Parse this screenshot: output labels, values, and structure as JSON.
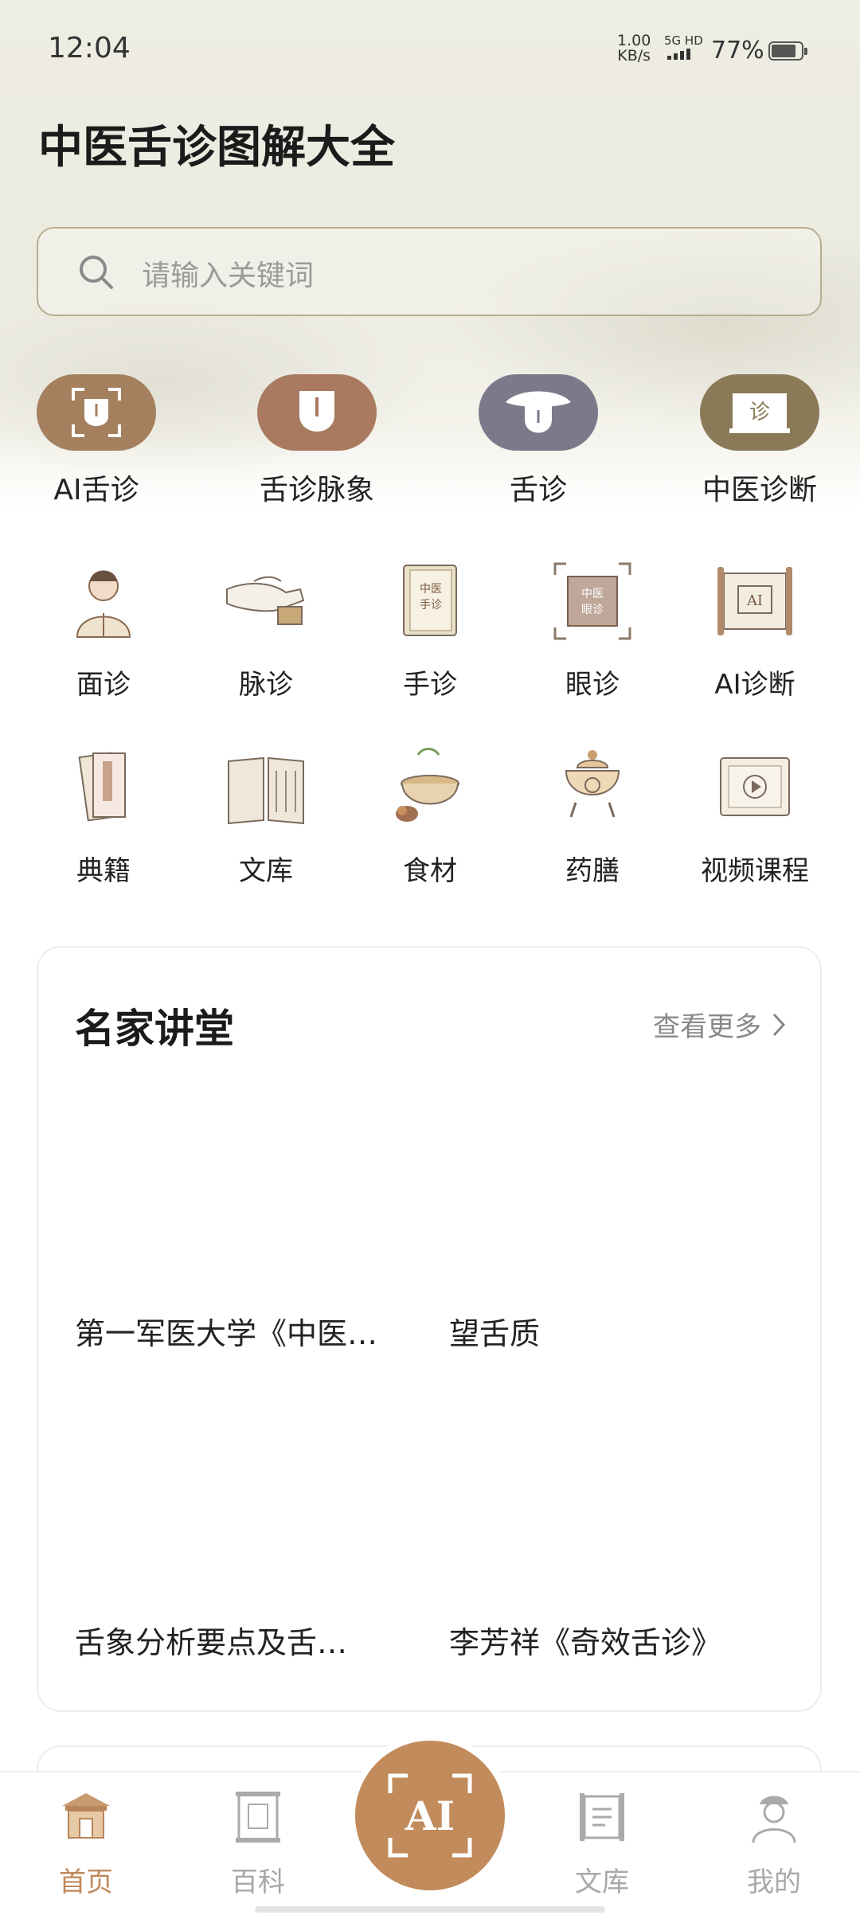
{
  "status_bar": {
    "time": "12:04",
    "net_speed_value": "1.00",
    "net_speed_unit": "KB/s",
    "network": "5G HD",
    "battery": "77%"
  },
  "header": {
    "title": "中医舌诊图解大全"
  },
  "search": {
    "placeholder": "请输入关键词"
  },
  "featured": [
    {
      "label": "AI舌诊",
      "icon": "ai-tongue-scan-icon",
      "color": "#a4805f"
    },
    {
      "label": "舌诊脉象",
      "icon": "tongue-icon",
      "color": "#a97a60"
    },
    {
      "label": "舌诊",
      "icon": "mouth-tongue-icon",
      "color": "#7c7a8a"
    },
    {
      "label": "中医诊断",
      "icon": "diagnosis-book-icon",
      "color": "#8b7a58"
    }
  ],
  "categories": [
    {
      "label": "面诊",
      "icon": "face-doctor-icon"
    },
    {
      "label": "脉诊",
      "icon": "pulse-hand-icon"
    },
    {
      "label": "手诊",
      "icon": "hand-book-icon"
    },
    {
      "label": "眼诊",
      "icon": "eye-diagnosis-icon"
    },
    {
      "label": "AI诊断",
      "icon": "ai-scroll-icon"
    },
    {
      "label": "典籍",
      "icon": "classics-books-icon"
    },
    {
      "label": "文库",
      "icon": "library-book-icon"
    },
    {
      "label": "食材",
      "icon": "ingredients-pot-icon"
    },
    {
      "label": "药膳",
      "icon": "medicinal-food-icon"
    },
    {
      "label": "视频课程",
      "icon": "video-course-icon"
    }
  ],
  "lectures": {
    "title": "名家讲堂",
    "more": "查看更多",
    "items": [
      "第一军医大学《中医…",
      "望舌质",
      "舌象分析要点及舌…",
      "李芳祥《奇效舌诊》"
    ]
  },
  "tabbar": {
    "items": [
      {
        "label": "首页",
        "icon": "home-icon",
        "active": true
      },
      {
        "label": "百科",
        "icon": "encyclopedia-scroll-icon",
        "active": false
      },
      {
        "label": "AI",
        "icon": "ai-scan-icon",
        "active": false
      },
      {
        "label": "文库",
        "icon": "library-scroll-icon",
        "active": false
      },
      {
        "label": "我的",
        "icon": "profile-icon",
        "active": false
      }
    ]
  },
  "colors": {
    "accent": "#c28b5c",
    "active_tab": "#c0885a",
    "inactive_tab": "#a8a8a8"
  }
}
